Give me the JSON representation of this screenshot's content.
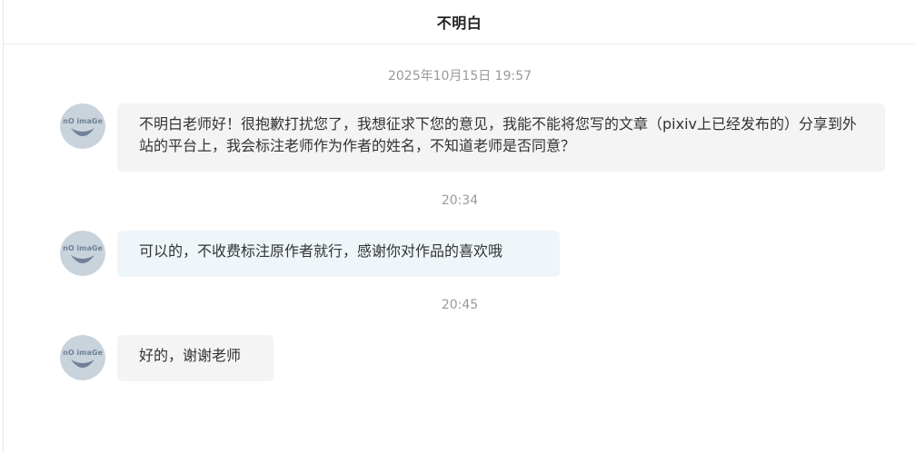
{
  "header": {
    "title": "不明白"
  },
  "messages": [
    {
      "timestamp": "2025年10月15日 19:57",
      "avatar_text": "nO imaGe",
      "text": "不明白老师好！很抱歉打扰您了，我想征求下您的意见，我能不能将您写的文章（pixiv上已经发布的）分享到外站的平台上，我会标注老师作为作者的姓名，不知道老师是否同意？"
    },
    {
      "timestamp": "20:34",
      "avatar_text": "nO imaGe",
      "text": "可以的，不收费标注原作者就行，感谢你对作品的喜欢哦"
    },
    {
      "timestamp": "20:45",
      "avatar_text": "nO imaGe",
      "text": "好的，谢谢老师"
    }
  ],
  "colors": {
    "bubble_grey": "#f4f4f4",
    "bubble_blue": "#eef6fa",
    "avatar_bg": "#c9d3dc",
    "avatar_fg": "#6f8296"
  }
}
